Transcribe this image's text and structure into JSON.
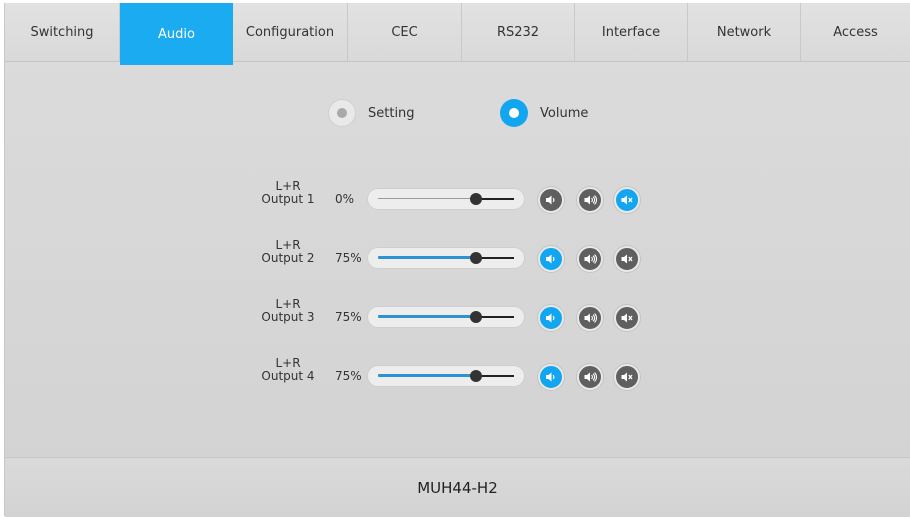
{
  "tabs": [
    {
      "label": "Switching",
      "active": false
    },
    {
      "label": "Audio",
      "active": true
    },
    {
      "label": "Configuration",
      "active": false
    },
    {
      "label": "CEC",
      "active": false
    },
    {
      "label": "RS232",
      "active": false
    },
    {
      "label": "Interface",
      "active": false
    },
    {
      "label": "Network",
      "active": false
    },
    {
      "label": "Access",
      "active": false
    }
  ],
  "mode": {
    "setting_label": "Setting",
    "volume_label": "Volume",
    "selected": "Volume"
  },
  "channels": [
    {
      "line1": "L+R",
      "line2": "Output 1",
      "percent_text": "0%",
      "slider_position": 0.72,
      "fill_visible": false,
      "active_button": "mute"
    },
    {
      "line1": "L+R",
      "line2": "Output 2",
      "percent_text": "75%",
      "slider_position": 0.72,
      "fill_visible": true,
      "active_button": "volume-down"
    },
    {
      "line1": "L+R",
      "line2": "Output 3",
      "percent_text": "75%",
      "slider_position": 0.72,
      "fill_visible": true,
      "active_button": "volume-down"
    },
    {
      "line1": "L+R",
      "line2": "Output 4",
      "percent_text": "75%",
      "slider_position": 0.72,
      "fill_visible": true,
      "active_button": "volume-down"
    }
  ],
  "icons": {
    "volume_down": "speaker-low-icon",
    "volume_up": "speaker-high-icon",
    "mute": "speaker-mute-icon"
  },
  "colors": {
    "accent": "#12a6f0",
    "button_inactive": "#5f5f5f",
    "tab_active": "#1aabf0"
  },
  "footer": {
    "model": "MUH44-H2"
  }
}
